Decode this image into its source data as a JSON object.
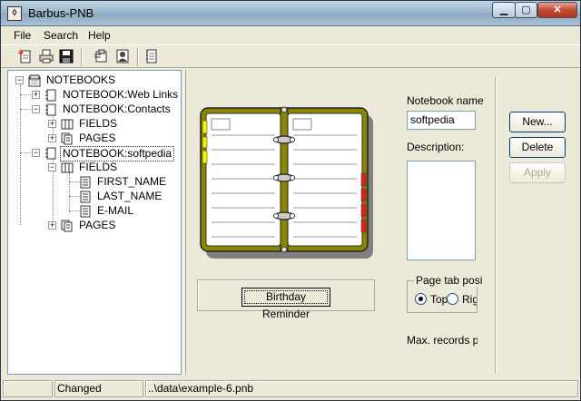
{
  "window": {
    "title": "Barbus-PNB"
  },
  "menu": {
    "file": "File",
    "search": "Search",
    "help": "Help"
  },
  "toolbar": {
    "items": [
      "new-note-icon",
      "print-icon",
      "save-icon",
      "notepad-icon",
      "contacts-icon",
      "notebook-icon"
    ]
  },
  "tree": {
    "root": "NOTEBOOKS",
    "nb_web": "NOTEBOOK:Web Links",
    "nb_contacts": "NOTEBOOK:Contacts",
    "fields1": "FIELDS",
    "pages1": "PAGES",
    "nb_softpedia": "NOTEBOOK:softpedia",
    "fields2": "FIELDS",
    "first_name": "FIRST_NAME",
    "last_name": "LAST_NAME",
    "email": "E-MAIL",
    "pages2": "PAGES"
  },
  "form": {
    "notebook_name_label": "Notebook name",
    "notebook_name_value": "softpedia",
    "description_label": "Description:",
    "description_value": "",
    "page_tab_label": "Page tab position",
    "top_label": "Top",
    "right_label": "Right",
    "max_records_label": "Max. records per page",
    "birthday_button": "Birthday Reminder",
    "new_button": "New...",
    "delete_button": "Delete",
    "apply_button": "Apply"
  },
  "status": {
    "state": "Changed",
    "file": "..\\data\\example-6.pnb"
  },
  "colors": {
    "cover": "#8b8600",
    "tab_yellow": "#f2f200",
    "tab_red": "#e02020"
  }
}
